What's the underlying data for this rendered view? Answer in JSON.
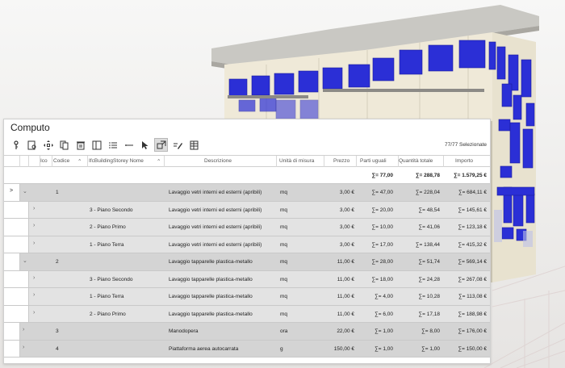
{
  "panel": {
    "title": "Computo",
    "selection_count": "77/77 Selezionate"
  },
  "toolbar": {
    "icons": [
      "key-icon",
      "tag-search-icon",
      "move-icon",
      "copy-icon",
      "delete-icon",
      "columns-icon",
      "list-icon",
      "dash-icon",
      "pointer-select-icon",
      "isolate-icon",
      "edit-lines-icon",
      "grid-export-icon"
    ]
  },
  "columns": {
    "ico": "Ico",
    "codice": "Codice",
    "storey": "IfcBuildingStorey Nome",
    "descrizione": "Descrizione",
    "unita": "Unità di misura",
    "prezzo": "Prezzo",
    "parti": "Parti uguali",
    "quantita": "Quantità totale",
    "importo": "Importo"
  },
  "totals": {
    "parti": "∑= 77,00",
    "quantita": "∑= 288,78",
    "importo": "∑= 1.579,25 €"
  },
  "rows": [
    {
      "level": 0,
      "expand": "⌄",
      "codice": "1",
      "storey": "",
      "descrizione": "Lavaggio vetri interni ed esterni (apribili)",
      "unita": "mq",
      "prezzo": "3,00 €",
      "parti": "∑= 47,00",
      "quantita": "∑= 228,04",
      "importo": "∑= 684,11 €",
      "marker": ">"
    },
    {
      "level": 1,
      "expand": "›",
      "codice": "",
      "storey": "3 - Piano Secondo",
      "descrizione": "Lavaggio vetri interni ed esterni (apribili)",
      "unita": "mq",
      "prezzo": "3,00 €",
      "parti": "∑= 20,00",
      "quantita": "∑= 48,54",
      "importo": "∑= 145,61 €"
    },
    {
      "level": 1,
      "expand": "›",
      "codice": "",
      "storey": "2 - Piano Primo",
      "descrizione": "Lavaggio vetri interni ed esterni (apribili)",
      "unita": "mq",
      "prezzo": "3,00 €",
      "parti": "∑= 10,00",
      "quantita": "∑= 41,06",
      "importo": "∑= 123,18 €"
    },
    {
      "level": 1,
      "expand": "›",
      "codice": "",
      "storey": "1 - Piano Terra",
      "descrizione": "Lavaggio vetri interni ed esterni (apribili)",
      "unita": "mq",
      "prezzo": "3,00 €",
      "parti": "∑= 17,00",
      "quantita": "∑= 138,44",
      "importo": "∑= 415,32 €"
    },
    {
      "level": 0,
      "expand": "⌄",
      "codice": "2",
      "storey": "",
      "descrizione": "Lavaggio tapparelle plastica-metallo",
      "unita": "mq",
      "prezzo": "11,00 €",
      "parti": "∑= 28,00",
      "quantita": "∑= 51,74",
      "importo": "∑= 569,14 €"
    },
    {
      "level": 1,
      "expand": "›",
      "codice": "",
      "storey": "3 - Piano Secondo",
      "descrizione": "Lavaggio tapparelle plastica-metallo",
      "unita": "mq",
      "prezzo": "11,00 €",
      "parti": "∑= 18,00",
      "quantita": "∑= 24,28",
      "importo": "∑= 267,08 €"
    },
    {
      "level": 1,
      "expand": "›",
      "codice": "",
      "storey": "1 - Piano Terra",
      "descrizione": "Lavaggio tapparelle plastica-metallo",
      "unita": "mq",
      "prezzo": "11,00 €",
      "parti": "∑= 4,00",
      "quantita": "∑= 10,28",
      "importo": "∑= 113,08 €"
    },
    {
      "level": 1,
      "expand": "›",
      "codice": "",
      "storey": "2 - Piano Primo",
      "descrizione": "Lavaggio tapparelle plastica-metallo",
      "unita": "mq",
      "prezzo": "11,00 €",
      "parti": "∑= 6,00",
      "quantita": "∑= 17,18",
      "importo": "∑= 188,98 €"
    },
    {
      "level": 0,
      "expand": "›",
      "codice": "3",
      "storey": "",
      "descrizione": "Manodopera",
      "unita": "ora",
      "prezzo": "22,00 €",
      "parti": "∑= 1,00",
      "quantita": "∑= 8,00",
      "importo": "∑= 176,00 €"
    },
    {
      "level": 0,
      "expand": "›",
      "codice": "4",
      "storey": "",
      "descrizione": "Piattaforma aerea autocarrata",
      "unita": "g",
      "prezzo": "150,00 €",
      "parti": "∑= 1,00",
      "quantita": "∑= 1,00",
      "importo": "∑= 150,00 €"
    }
  ],
  "colors": {
    "window_blue": "#2b2fd6",
    "group_row": "#d4d4d4",
    "child_row": "#e3e3e3"
  }
}
